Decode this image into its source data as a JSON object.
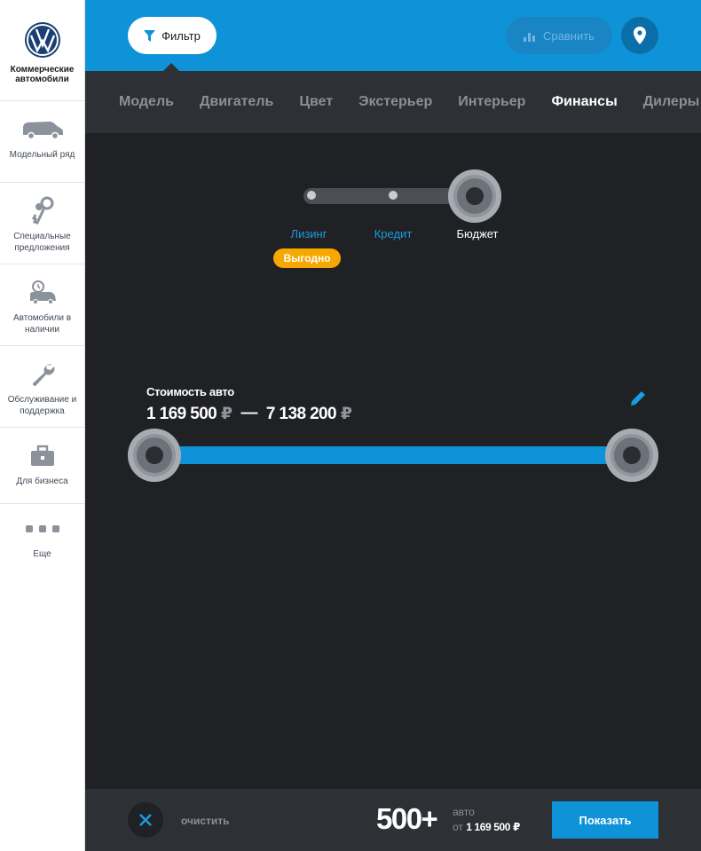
{
  "sidebar": {
    "brand_title": "Коммерческие автомобили",
    "items": [
      {
        "label": "Модельный ряд",
        "icon": "van-icon"
      },
      {
        "label": "Специальные предложения",
        "icon": "keys-icon"
      },
      {
        "label": "Автомобили в наличии",
        "icon": "car-clock-icon"
      },
      {
        "label": "Обслуживание и поддержка",
        "icon": "wrench-icon"
      },
      {
        "label": "Для бизнеса",
        "icon": "briefcase-icon"
      },
      {
        "label": "Еще",
        "icon": "more-dots-icon"
      }
    ]
  },
  "topbar": {
    "filter_label": "Фильтр",
    "compare_label": "Сравнить"
  },
  "tabs": [
    {
      "label": "Модель",
      "active": false
    },
    {
      "label": "Двигатель",
      "active": false
    },
    {
      "label": "Цвет",
      "active": false
    },
    {
      "label": "Экстерьер",
      "active": false
    },
    {
      "label": "Интерьер",
      "active": false
    },
    {
      "label": "Финансы",
      "active": true
    },
    {
      "label": "Дилеры",
      "active": false
    }
  ],
  "finance": {
    "options": [
      "Лизинг",
      "Кредит",
      "Бюджет"
    ],
    "selected": "Бюджет",
    "badge": "Выгодно"
  },
  "price": {
    "title": "Стоимость авто",
    "min": "1 169 500",
    "max": "7 138 200",
    "currency": "₽",
    "dash": "—"
  },
  "bottombar": {
    "clear_label": "очистить",
    "count": "500+",
    "count_unit": "авто",
    "from_label": "от",
    "from_price": "1 169 500 ₽",
    "show_label": "Показать"
  },
  "colors": {
    "accent": "#0e93d8",
    "badge": "#f6a800",
    "dark_bg": "#1f2124",
    "panel_bg": "#2d3035"
  }
}
